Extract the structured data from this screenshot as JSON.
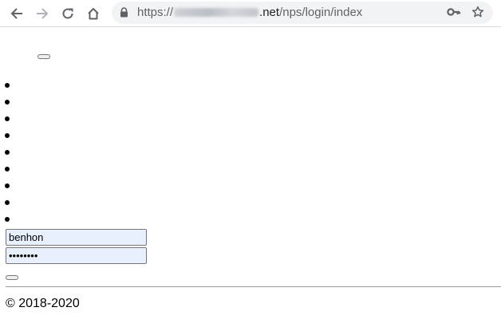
{
  "browser": {
    "url_scheme": "https://",
    "url_host_suffix": ".net",
    "url_path": "/nps/login/index",
    "icons": {
      "back": "back-arrow-icon",
      "forward": "forward-arrow-icon",
      "reload": "reload-icon",
      "home": "home-icon",
      "lock": "lock-icon",
      "key": "key-icon",
      "star": "star-icon"
    }
  },
  "nav": {
    "item_count": 9
  },
  "login": {
    "username_value": "benhon",
    "password_value": "••••••••"
  },
  "footer": {
    "copyright": "© 2018-2020"
  },
  "colors": {
    "autofill_bg": "#e8f0fe",
    "omnibox_bg": "#f1f3f4"
  }
}
